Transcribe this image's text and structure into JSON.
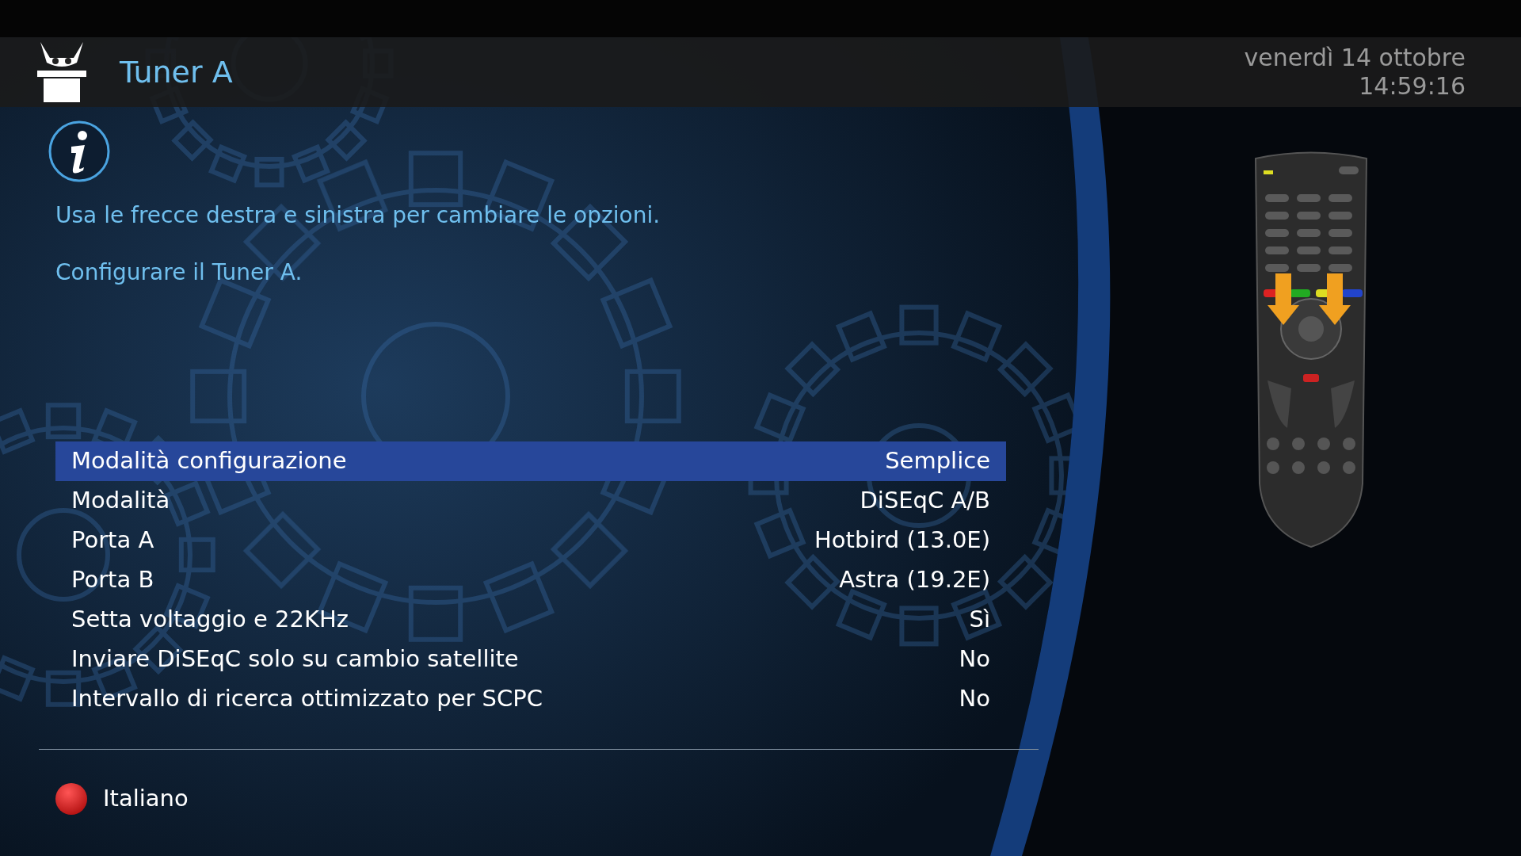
{
  "header": {
    "title": "Tuner A",
    "date": "venerdì 14 ottobre",
    "time": "14:59:16"
  },
  "description": [
    "Usa le frecce destra e sinistra per cambiare le opzioni.",
    "Configurare il Tuner A."
  ],
  "settings": [
    {
      "label": "Modalità configurazione",
      "value": "Semplice",
      "selected": true
    },
    {
      "label": "Modalità",
      "value": "DiSEqC A/B",
      "selected": false
    },
    {
      "label": "Porta A",
      "value": "Hotbird (13.0E)",
      "selected": false
    },
    {
      "label": "Porta B",
      "value": "Astra (19.2E)",
      "selected": false
    },
    {
      "label": "Setta voltaggio e 22KHz",
      "value": "Sì",
      "selected": false
    },
    {
      "label": "Inviare DiSEqC solo su cambio satellite",
      "value": "No",
      "selected": false
    },
    {
      "label": "Intervallo di ricerca ottimizzato per SCPC",
      "value": "No",
      "selected": false
    }
  ],
  "footer": {
    "red_button": {
      "label": "Italiano"
    }
  }
}
